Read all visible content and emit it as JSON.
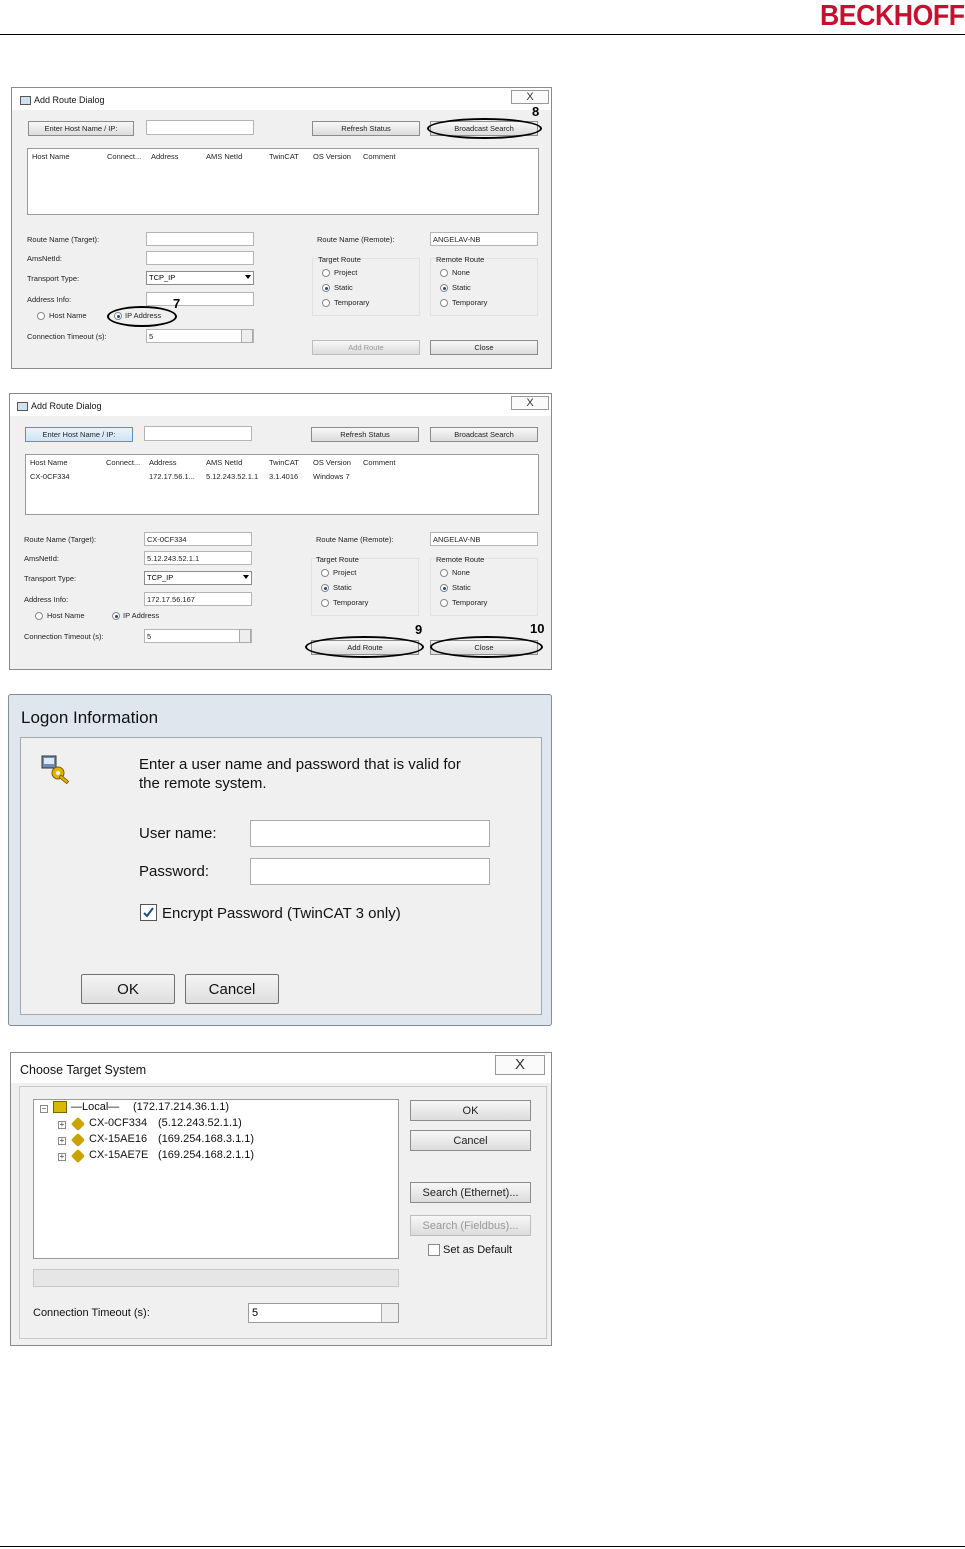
{
  "brand": {
    "logo_text": "BECKHOFF",
    "color": "#c8102e"
  },
  "dialog1": {
    "title": "Add Route Dialog",
    "close_glyph": "X",
    "enter_host_label": "Enter Host Name / IP:",
    "refresh_label": "Refresh Status",
    "broadcast_label": "Broadcast Search",
    "columns": [
      "Host Name",
      "Connect...",
      "Address",
      "AMS NetId",
      "TwinCAT",
      "OS Version",
      "Comment"
    ],
    "route_name_target_label": "Route Name (Target):",
    "route_name_target_value": "",
    "amsnetid_label": "AmsNetId:",
    "amsnetid_value": "",
    "transport_label": "Transport Type:",
    "transport_value": "TCP_IP",
    "address_info_label": "Address Info:",
    "address_info_value": "",
    "host_name_radio": "Host Name",
    "ip_address_radio": "IP Address",
    "timeout_label": "Connection Timeout (s):",
    "timeout_value": "5",
    "route_name_remote_label": "Route Name (Remote):",
    "route_name_remote_value": "ANGELAV-NB",
    "target_route_label": "Target Route",
    "target_options": [
      "Project",
      "Static",
      "Temporary"
    ],
    "remote_route_label": "Remote Route",
    "remote_options": [
      "None",
      "Static",
      "Temporary"
    ],
    "add_route_label": "Add Route",
    "close_label": "Close",
    "callout_7": "7",
    "callout_8": "8"
  },
  "dialog2": {
    "title": "Add Route Dialog",
    "close_glyph": "X",
    "enter_host_label": "Enter Host Name / IP:",
    "refresh_label": "Refresh Status",
    "broadcast_label": "Broadcast Search",
    "columns": [
      "Host Name",
      "Connect...",
      "Address",
      "AMS NetId",
      "TwinCAT",
      "OS Version",
      "Comment"
    ],
    "row": [
      "CX-0CF334",
      "",
      "172.17.56.1...",
      "5.12.243.52.1.1",
      "3.1.4016",
      "Windows 7",
      ""
    ],
    "route_name_target_label": "Route Name (Target):",
    "route_name_target_value": "CX-0CF334",
    "amsnetid_label": "AmsNetId:",
    "amsnetid_value": "5.12.243.52.1.1",
    "transport_label": "Transport Type:",
    "transport_value": "TCP_IP",
    "address_info_label": "Address Info:",
    "address_info_value": "172.17.56.167",
    "host_name_radio": "Host Name",
    "ip_address_radio": "IP Address",
    "timeout_label": "Connection Timeout (s):",
    "timeout_value": "5",
    "route_name_remote_label": "Route Name (Remote):",
    "route_name_remote_value": "ANGELAV-NB",
    "target_route_label": "Target Route",
    "target_options": [
      "Project",
      "Static",
      "Temporary"
    ],
    "remote_route_label": "Remote Route",
    "remote_options": [
      "None",
      "Static",
      "Temporary"
    ],
    "add_route_label": "Add Route",
    "close_label": "Close",
    "callout_9": "9",
    "callout_10": "10"
  },
  "logon": {
    "title": "Logon Information",
    "message_line1": "Enter a user name and password that is valid for",
    "message_line2": "the remote system.",
    "user_label": "User name:",
    "user_value": "",
    "password_label": "Password:",
    "password_value": "",
    "encrypt_label": "Encrypt Password (TwinCAT 3 only)",
    "encrypt_checked": true,
    "ok_label": "OK",
    "cancel_label": "Cancel"
  },
  "choose": {
    "title": "Choose Target System",
    "close_glyph": "X",
    "tree": [
      {
        "name": "—Local—",
        "address": "(172.17.214.36.1.1)"
      },
      {
        "name": "CX-0CF334",
        "address": "(5.12.243.52.1.1)"
      },
      {
        "name": "CX-15AE16",
        "address": "(169.254.168.3.1.1)"
      },
      {
        "name": "CX-15AE7E",
        "address": "(169.254.168.2.1.1)"
      }
    ],
    "ok_label": "OK",
    "cancel_label": "Cancel",
    "search_ethernet_label": "Search (Ethernet)...",
    "search_fieldbus_label": "Search (Fieldbus)...",
    "set_default_label": "Set as Default",
    "timeout_label": "Connection Timeout (s):",
    "timeout_value": "5"
  }
}
